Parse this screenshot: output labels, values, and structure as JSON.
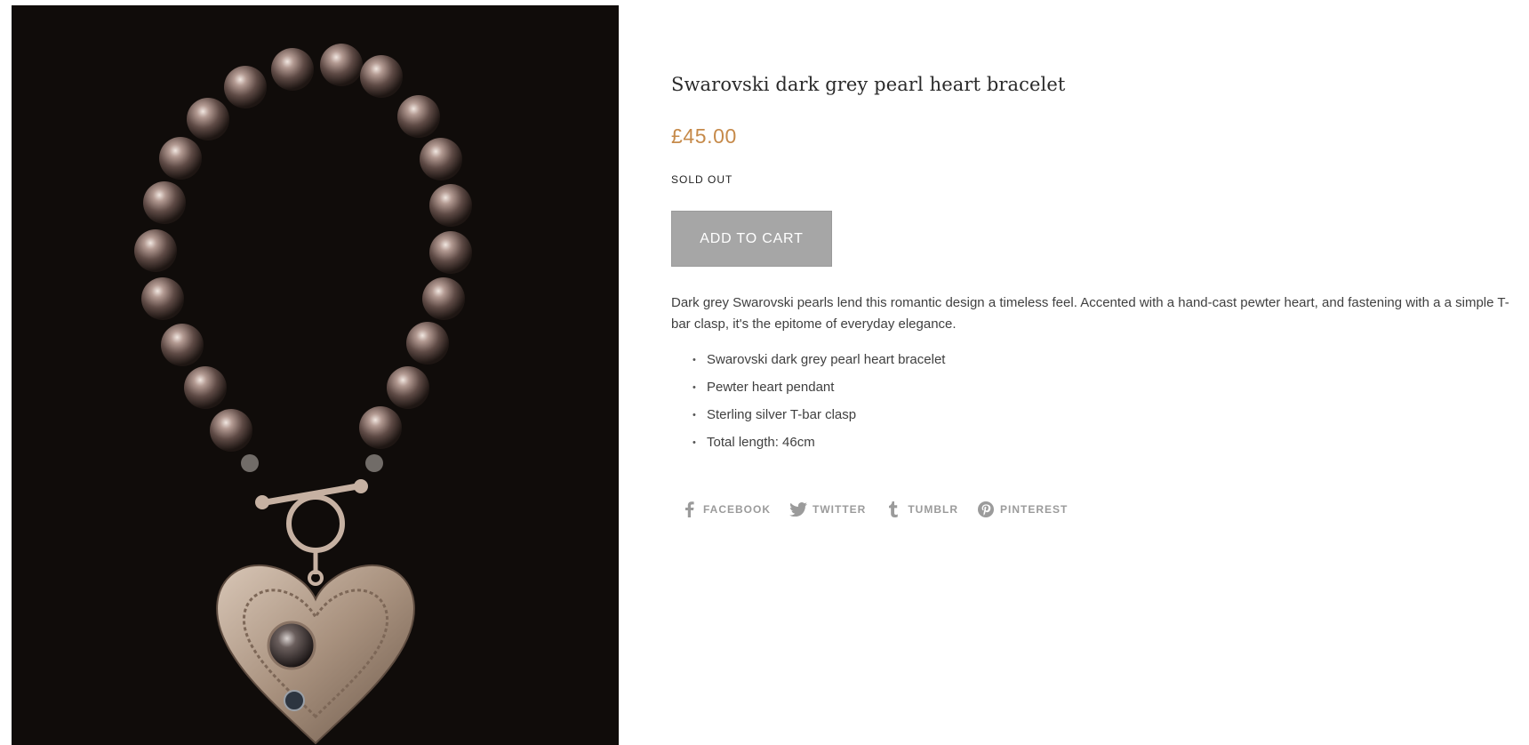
{
  "product": {
    "title": "Swarovski dark grey pearl heart bracelet",
    "price": "£45.00",
    "stock_status": "SOLD OUT",
    "add_to_cart_label": "ADD TO CART",
    "description": "Dark grey Swarovski pearls lend this romantic design a timeless feel. Accented with a hand-cast pewter heart, and fastening with a a simple T-bar clasp, it's the epitome of everyday elegance.",
    "features": [
      "Swarovski dark grey pearl heart bracelet",
      "Pewter heart pendant",
      "Sterling silver T-bar clasp",
      "Total length: 46cm"
    ]
  },
  "share": [
    {
      "label": "FACEBOOK",
      "icon": "facebook-icon"
    },
    {
      "label": "TWITTER",
      "icon": "twitter-icon"
    },
    {
      "label": "TUMBLR",
      "icon": "tumblr-icon"
    },
    {
      "label": "PINTEREST",
      "icon": "pinterest-icon"
    }
  ],
  "colors": {
    "price": "#c68a4a",
    "button": "#a6a6a6",
    "share_text": "#9b9b9b"
  }
}
